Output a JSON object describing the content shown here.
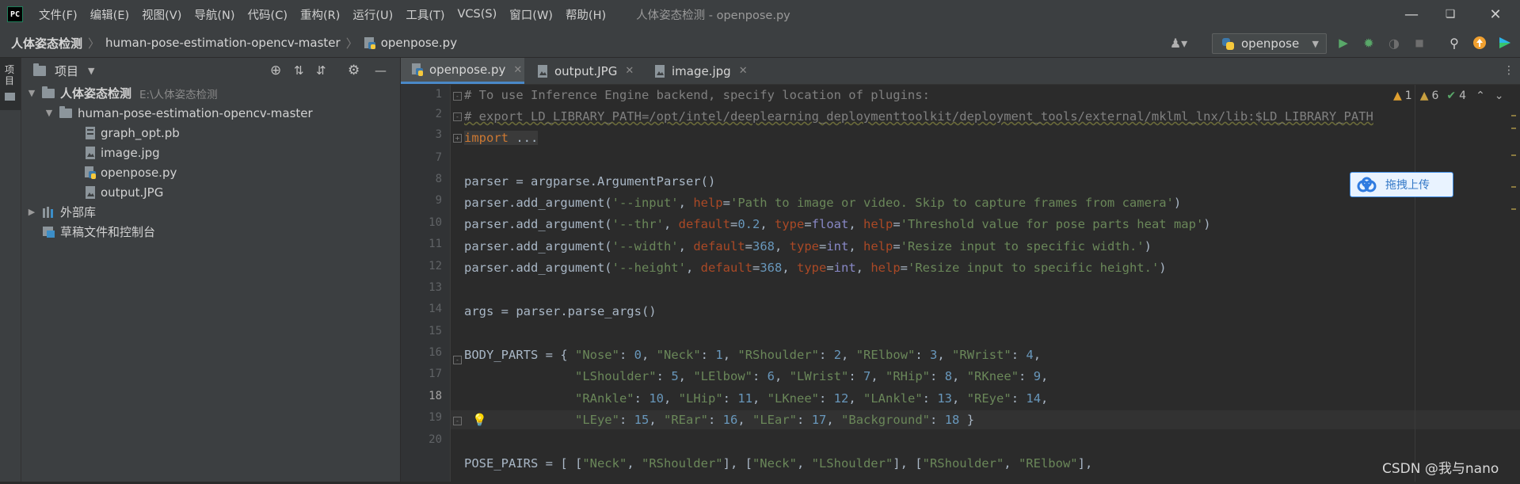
{
  "menubar": {
    "items": [
      "文件(F)",
      "编辑(E)",
      "视图(V)",
      "导航(N)",
      "代码(C)",
      "重构(R)",
      "运行(U)",
      "工具(T)",
      "VCS(S)",
      "窗口(W)",
      "帮助(H)"
    ],
    "window_title": "人体姿态检测 - openpose.py"
  },
  "navbar": {
    "crumbs": [
      "人体姿态检测",
      "human-pose-estimation-opencv-master",
      "openpose.py"
    ],
    "run_config": "openpose"
  },
  "project": {
    "title": "项目",
    "side_tab": "项目",
    "tree": [
      {
        "label": "人体姿态检测",
        "hint": "E:\\人体姿态检测",
        "type": "folder",
        "expanded": true
      },
      {
        "label": "human-pose-estimation-opencv-master",
        "type": "folder",
        "expanded": true
      },
      {
        "label": "graph_opt.pb",
        "type": "file"
      },
      {
        "label": "image.jpg",
        "type": "image"
      },
      {
        "label": "openpose.py",
        "type": "python"
      },
      {
        "label": "output.JPG",
        "type": "image"
      },
      {
        "label": "外部库",
        "type": "library"
      },
      {
        "label": "草稿文件和控制台",
        "type": "scratch"
      }
    ]
  },
  "tabs": [
    {
      "label": "openpose.py",
      "active": true
    },
    {
      "label": "output.JPG",
      "active": false
    },
    {
      "label": "image.jpg",
      "active": false
    }
  ],
  "inspections": {
    "warnings_a": "1",
    "warnings_b": "6",
    "ok": "4"
  },
  "editor": {
    "line_numbers": [
      "1",
      "2",
      "3",
      "7",
      "8",
      "9",
      "10",
      "11",
      "12",
      "13",
      "14",
      "15",
      "16",
      "17",
      "18",
      "19",
      "20"
    ],
    "current_line": "18"
  },
  "overlay": {
    "upload_label": "拖拽上传",
    "watermark": "CSDN @我与nano"
  },
  "colors": {
    "accent": "#4a88c7",
    "run": "#59a869",
    "background": "#2b2b2b"
  }
}
